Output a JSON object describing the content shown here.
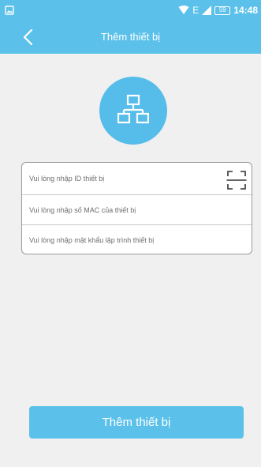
{
  "status_bar": {
    "network_type": "E",
    "battery_level": "59",
    "time": "14:48"
  },
  "header": {
    "title": "Thêm thiết bị",
    "back_icon": "chevron-left-icon"
  },
  "device_icon": "network-topology-icon",
  "form": {
    "device_id_placeholder": "Vui lòng nhập ID thiết bị",
    "mac_placeholder": "Vui lòng nhập số MAC của thiết bị",
    "programming_password_placeholder": "Vui lòng nhập mật khẩu lập trình thiết bị",
    "scan_icon": "scan-frame-icon"
  },
  "primary_button": {
    "label": "Thêm thiết bị"
  },
  "colors": {
    "accent": "#5cc1ea",
    "background": "#f0f0f0",
    "card_border": "#9a9a9a"
  }
}
